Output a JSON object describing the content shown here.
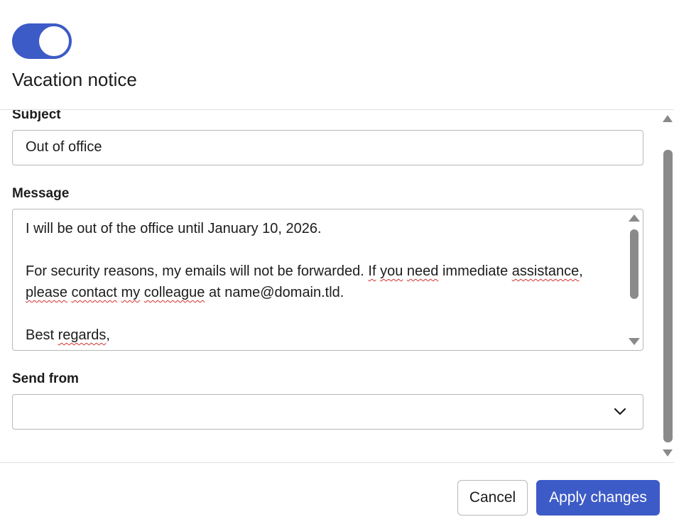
{
  "header": {
    "toggle_on": true,
    "title": "Vacation notice"
  },
  "form": {
    "subject": {
      "label": "Subject",
      "value": "Out of office"
    },
    "message": {
      "label": "Message",
      "lines": [
        "I will be out of the office until January 10, 2026.",
        "",
        "For security reasons, my emails will not be forwarded. If you need immediate assistance,",
        "please contact my colleague at name@domain.tld.",
        "",
        "Best regards,"
      ]
    },
    "send_from": {
      "label": "Send from",
      "value": ""
    }
  },
  "footer": {
    "cancel_label": "Cancel",
    "apply_label": "Apply changes"
  },
  "colors": {
    "accent": "#3d5bc7",
    "spellcheck": "#d63030",
    "border": "#b8b8b8"
  },
  "icons": [
    "chevron-down-icon",
    "scroll-up-arrow-icon",
    "scroll-down-arrow-icon"
  ]
}
